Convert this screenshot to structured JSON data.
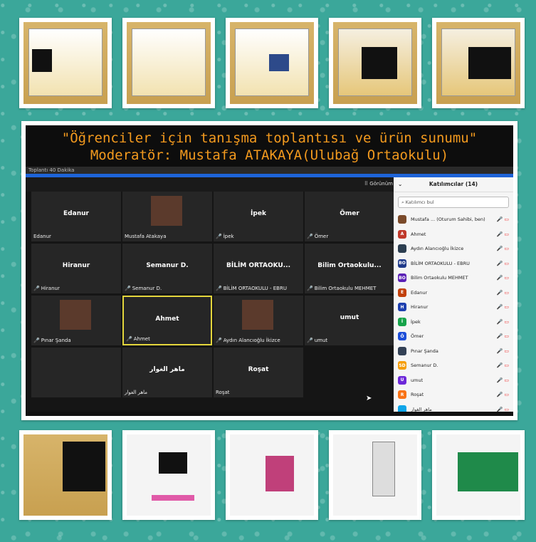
{
  "caption": {
    "line1": "\"Öğrenciler için tanışma toplantısı ve ürün sunumu\"",
    "line2": "Moderatör: Mustafa ATAKAYA(Ulubağ Ortaokulu)"
  },
  "meeting": {
    "timer_label": "Toplantı 40 Dakika",
    "view_label": "Görünüm"
  },
  "tiles": [
    {
      "name": "Edanur",
      "label": "Edanur",
      "muted": false
    },
    {
      "name": "",
      "label": "Mustafa Atakaya",
      "muted": false,
      "video": true
    },
    {
      "name": "İpek",
      "label": "İpek",
      "muted": true
    },
    {
      "name": "Ömer",
      "label": "Ömer",
      "muted": true
    },
    {
      "name": "Hiranur",
      "label": "Hiranur",
      "muted": true
    },
    {
      "name": "Semanur D.",
      "label": "Semanur D.",
      "muted": true
    },
    {
      "name": "BİLİM ORTAOKU...",
      "label": "BİLİM ORTAOKULU - EBRU",
      "muted": true
    },
    {
      "name": "Bilim Ortaokulu...",
      "label": "Bilim Ortaokulu MEHMET",
      "muted": true
    },
    {
      "name": "",
      "label": "Pınar Şanda",
      "muted": true,
      "video": true
    },
    {
      "name": "Ahmet",
      "label": "Ahmet",
      "muted": true,
      "active": true
    },
    {
      "name": "",
      "label": "Aydın Alancıoğlu İkizce",
      "muted": true,
      "video": true
    },
    {
      "name": "umut",
      "label": "umut",
      "muted": true
    },
    {
      "name": "",
      "label": "",
      "muted": false
    },
    {
      "name": "ماهر الغوار",
      "label": "ماهر الغوار",
      "muted": false
    },
    {
      "name": "Roşat",
      "label": "Roşat",
      "muted": false
    }
  ],
  "participants_panel": {
    "title": "Katılımcılar (14)",
    "search_placeholder": "Katılımcı bul",
    "list": [
      {
        "initial": "",
        "name": "Mustafa ...  (Oturum Sahibi, ben)",
        "color": "#7a4a2a"
      },
      {
        "initial": "A",
        "name": "Ahmet",
        "color": "#c0392b"
      },
      {
        "initial": "",
        "name": "Aydın Alancıoğlu İkizce",
        "color": "#2c3e50"
      },
      {
        "initial": "BO",
        "name": "BİLİM ORTAOKULU - EBRU",
        "color": "#1f3a8a"
      },
      {
        "initial": "BO",
        "name": "Bilim Ortaokulu MEHMET",
        "color": "#5b21b6"
      },
      {
        "initial": "E",
        "name": "Edanur",
        "color": "#c2410c"
      },
      {
        "initial": "H",
        "name": "Hiranur",
        "color": "#1e40af"
      },
      {
        "initial": "İ",
        "name": "İpek",
        "color": "#16a34a"
      },
      {
        "initial": "Ö",
        "name": "Ömer",
        "color": "#1d4ed8"
      },
      {
        "initial": "",
        "name": "Pınar Şanda",
        "color": "#334155"
      },
      {
        "initial": "SD",
        "name": "Semanur D.",
        "color": "#f59e0b"
      },
      {
        "initial": "U",
        "name": "umut",
        "color": "#6d28d9"
      },
      {
        "initial": "R",
        "name": "Roşat",
        "color": "#f97316"
      },
      {
        "initial": "",
        "name": "ماهر الغوار",
        "color": "#0ea5e9"
      }
    ]
  }
}
